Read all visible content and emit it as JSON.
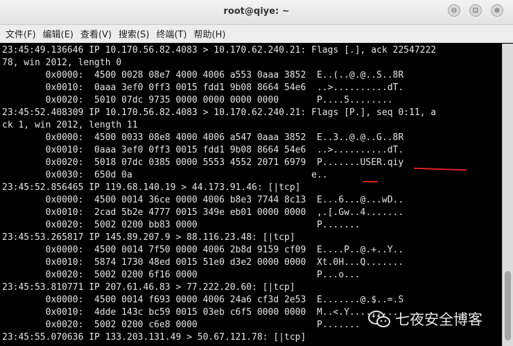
{
  "window": {
    "title": "root@qiye: ~"
  },
  "window_buttons": {
    "minimize": "⊖",
    "maximize": "⊡",
    "close": "⊗"
  },
  "menu": [
    {
      "label": "文件(F)"
    },
    {
      "label": "编辑(E)"
    },
    {
      "label": "查看(V)"
    },
    {
      "label": "搜索(S)"
    },
    {
      "label": "终端(T)"
    },
    {
      "label": "帮助(H)"
    }
  ],
  "terminal": {
    "lines": [
      "23:45:49.136646 IP 10.170.56.82.4083 > 10.170.62.240.21: Flags [.], ack 22547222",
      "78, win 2012, length 0",
      "        0x0000:  4500 0028 08e7 4000 4006 a553 0aaa 3852  E..(..@.@..S..8R",
      "        0x0010:  0aaa 3ef0 0ff3 0015 fdd1 9b08 8664 54e6  ..>..........dT.",
      "        0x0020:  5010 07dc 9735 0000 0000 0000 0000       P....5........",
      "23:45:52.408309 IP 10.170.56.82.4083 > 10.170.62.240.21: Flags [P.], seq 0:11, a",
      "ck 1, win 2012, length 11",
      "        0x0000:  4500 0033 08e8 4000 4006 a547 0aaa 3852  E..3..@.@..G..8R",
      "        0x0010:  0aaa 3ef0 0ff3 0015 fdd1 9b08 8664 54e6  ..>..........dT.",
      "        0x0020:  5018 07dc 0385 0000 5553 4552 2071 6979  P.......USER.qiy",
      "        0x0030:  650d 0a                                 e..",
      "23:45:52.856465 IP 119.68.140.19 > 44.173.91.46: [|tcp]",
      "        0x0000:  4500 0014 36ce 0000 4006 b8e3 7744 8c13  E...6...@...wD..",
      "        0x0010:  2cad 5b2e 4777 0015 349e eb01 0000 0000  ,.[.Gw..4.......",
      "        0x0020:  5002 0200 bb83 0000                      P.......",
      "23:45:53.265817 IP 145.89.207.9 > 88.116.23.48: [|tcp]",
      "        0x0000:  4500 0014 7f50 0000 4006 2b8d 9159 cf09  E....P..@.+..Y..",
      "        0x0010:  5874 1730 48ed 0015 51e0 d3e2 0000 0000  Xt.0H...Q.......",
      "        0x0020:  5002 0200 6f16 0000                      P...o...",
      "23:45:53.810771 IP 207.61.46.83 > 77.222.20.60: [|tcp]",
      "        0x0000:  4500 0014 f693 0000 4006 24a6 cf3d 2e53  E.......@.$..=.S",
      "        0x0010:  4dde 143c bc59 0015 03eb c6f5 0000 0000  M..<.Y..........",
      "        0x0020:  5002 0200 c6e8 0000                      P.......",
      "23:45:55.070636 IP 133.203.131.49 > 50.67.121.78: [|tcp]"
    ]
  },
  "watermark": {
    "text": "七夜安全博客"
  },
  "colors": {
    "terminal_bg": "#000000",
    "terminal_fg": "#e6e6e6",
    "annotation": "#e02020"
  }
}
